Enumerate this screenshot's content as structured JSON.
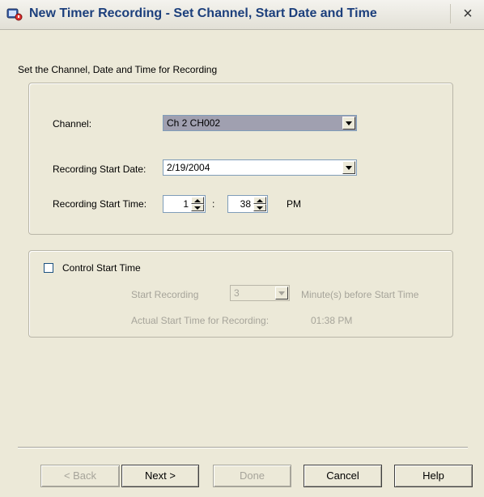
{
  "window": {
    "title": "New Timer Recording - Set Channel, Start Date and Time",
    "app_icon": "tv-recorder-icon",
    "close_label": "×"
  },
  "heading": "Set the Channel, Date and Time for Recording",
  "settings": {
    "channel_label": "Channel:",
    "channel_value": "Ch 2 CH002",
    "date_label": "Recording Start Date:",
    "date_value": "2/19/2004",
    "time_label": "Recording Start Time:",
    "hour_value": "1",
    "time_separator": ":",
    "minute_value": "38",
    "ampm": "PM"
  },
  "control": {
    "checkbox_label": "Control Start Time",
    "checked": false,
    "start_recording_label": "Start Recording",
    "minutes_value": "3",
    "minutes_suffix": "Minute(s) before Start Time",
    "actual_label": "Actual Start Time for Recording:",
    "actual_value": "01:38 PM"
  },
  "buttons": {
    "back": "< Back",
    "next": "Next >",
    "done": "Done",
    "cancel": "Cancel",
    "help": "Help"
  },
  "colors": {
    "selected_combo_bg": "#a0a0b0",
    "title_text": "#1c3f7c"
  }
}
